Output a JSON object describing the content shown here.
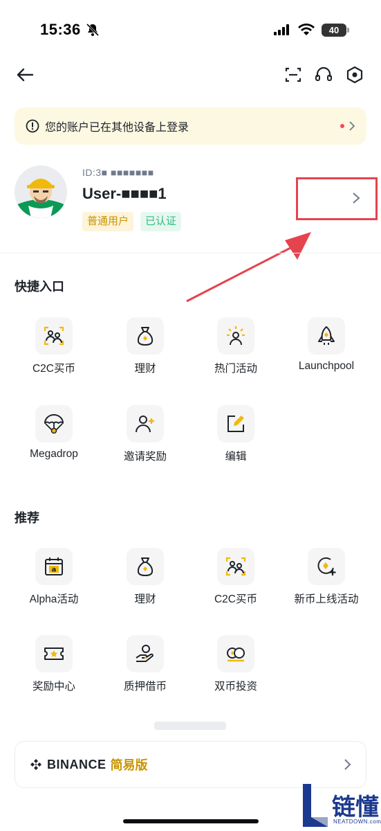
{
  "status_bar": {
    "time": "15:36",
    "battery": "40"
  },
  "notice": {
    "text": "您的账户已在其他设备上登录"
  },
  "profile": {
    "uid": "ID:3■ ■■■■■■■",
    "username": "User-■■■■1",
    "badge_normal": "普通用户",
    "badge_verified": "已认证"
  },
  "shortcuts": {
    "title": "快捷入口",
    "items": [
      {
        "label": "C2C买币",
        "icon": "c2c-users-icon"
      },
      {
        "label": "理财",
        "icon": "money-bag-icon"
      },
      {
        "label": "热门活动",
        "icon": "hot-activity-icon"
      },
      {
        "label": "Launchpool",
        "icon": "rocket-icon"
      },
      {
        "label": "Megadrop",
        "icon": "parachute-icon"
      },
      {
        "label": "邀请奖励",
        "icon": "invite-user-icon"
      },
      {
        "label": "编辑",
        "icon": "edit-icon"
      }
    ]
  },
  "recommended": {
    "title": "推荐",
    "items": [
      {
        "label": "Alpha活动",
        "icon": "alpha-calendar-icon"
      },
      {
        "label": "理财",
        "icon": "money-bag-icon"
      },
      {
        "label": "C2C买币",
        "icon": "c2c-users-icon"
      },
      {
        "label": "新币上线活动",
        "icon": "new-listing-icon"
      },
      {
        "label": "奖励中心",
        "icon": "reward-ticket-icon"
      },
      {
        "label": "质押借币",
        "icon": "loan-hand-icon"
      },
      {
        "label": "双币投资",
        "icon": "dual-coin-icon"
      }
    ]
  },
  "lite": {
    "brand": "BINANCE",
    "label": "简易版"
  },
  "watermark": {
    "text": "链懂",
    "sub": "NEATDOWN.com"
  },
  "colors": {
    "accent": "#F0B90B",
    "text": "#1E2329",
    "annotation": "#E5434E"
  }
}
